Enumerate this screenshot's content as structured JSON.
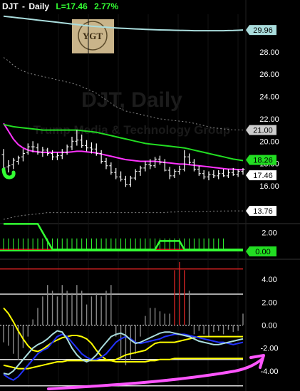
{
  "header": {
    "symbol": "DJT",
    "separator": "-",
    "interval": "Daily",
    "last_label": "L=17.46",
    "change_label": "2.77%"
  },
  "watermark": {
    "title": "DJT, Daily",
    "company": "Trump Media & Technology Group"
  },
  "logo": {
    "text": "YGT",
    "badge_color": "#c9b48a"
  },
  "colors": {
    "background": "#000000",
    "price_bars": "#ffffff",
    "ma_short": "#ff33ff",
    "ma_long": "#22dd22",
    "upper_band": "#aadddd",
    "band_dotted": "#888888",
    "oscillator_green": "#33ff33",
    "zero_red": "#dd2222",
    "hist_gray": "#888888",
    "hist_red": "#cc2222",
    "stoch_yellow": "#ffff00",
    "stoch_blue": "#2233ff",
    "stoch_lightblue": "#aadddd",
    "arrow_magenta": "#ff55ff"
  },
  "chart_data": [
    {
      "type": "line",
      "panel": "price",
      "y_ticks": [
        "28.00",
        "26.00",
        "24.00",
        "22.00",
        "20.00",
        "18.00",
        "16.00"
      ],
      "ylim": [
        13.0,
        31.5
      ],
      "badges": [
        {
          "label": "29.96",
          "bg": "#aadddd",
          "fg": "#000000",
          "value": 29.96
        },
        {
          "label": "21.00",
          "bg": "#cccccc",
          "fg": "#000000",
          "value": 21.0
        },
        {
          "label": "18.26",
          "bg": "#22dd22",
          "fg": "#000000",
          "value": 18.26
        },
        {
          "label": "17.46",
          "bg": "#ffffff",
          "fg": "#000000",
          "value": 17.46
        },
        {
          "label": "13.76",
          "bg": "#ffffff",
          "fg": "#000000",
          "value": 13.76
        }
      ],
      "ohlc": [
        [
          18.8,
          19.3,
          17.3,
          17.6
        ],
        [
          17.7,
          18.3,
          17.2,
          17.8
        ],
        [
          17.9,
          18.5,
          17.5,
          18.3
        ],
        [
          18.2,
          18.7,
          17.9,
          18.5
        ],
        [
          18.6,
          19.3,
          18.2,
          18.9
        ],
        [
          19.0,
          19.8,
          18.8,
          19.5
        ],
        [
          19.5,
          20.0,
          19.0,
          19.5
        ],
        [
          19.4,
          19.8,
          18.8,
          19.0
        ],
        [
          19.0,
          19.5,
          18.6,
          19.2
        ],
        [
          19.2,
          19.4,
          18.7,
          18.9
        ],
        [
          18.9,
          19.2,
          18.3,
          18.6
        ],
        [
          18.6,
          19.0,
          18.3,
          18.7
        ],
        [
          18.7,
          19.3,
          18.4,
          19.0
        ],
        [
          19.0,
          19.7,
          18.8,
          19.5
        ],
        [
          19.5,
          20.4,
          19.2,
          20.0
        ],
        [
          20.0,
          21.0,
          19.6,
          20.1
        ],
        [
          20.1,
          20.6,
          19.4,
          19.6
        ],
        [
          19.6,
          20.1,
          19.1,
          19.4
        ],
        [
          19.4,
          19.9,
          18.9,
          19.3
        ],
        [
          19.3,
          19.8,
          18.7,
          18.9
        ],
        [
          18.9,
          19.2,
          18.0,
          18.2
        ],
        [
          18.2,
          18.5,
          17.5,
          17.8
        ],
        [
          17.8,
          18.1,
          17.0,
          17.2
        ],
        [
          17.2,
          17.6,
          16.6,
          16.8
        ],
        [
          16.8,
          17.3,
          16.4,
          16.6
        ],
        [
          16.6,
          16.9,
          15.9,
          16.1
        ],
        [
          16.1,
          16.9,
          15.9,
          16.7
        ],
        [
          16.7,
          17.5,
          16.5,
          17.3
        ],
        [
          17.3,
          17.8,
          16.9,
          17.6
        ],
        [
          17.6,
          18.2,
          17.3,
          17.9
        ],
        [
          17.9,
          18.4,
          17.5,
          17.8
        ],
        [
          17.8,
          18.6,
          17.6,
          18.4
        ],
        [
          18.4,
          18.7,
          17.9,
          18.1
        ],
        [
          18.1,
          18.4,
          17.3,
          17.4
        ],
        [
          17.4,
          17.7,
          16.6,
          16.9
        ],
        [
          16.9,
          17.5,
          16.7,
          17.3
        ],
        [
          17.3,
          17.8,
          17.0,
          17.5
        ],
        [
          17.5,
          19.2,
          17.3,
          18.6
        ],
        [
          18.6,
          18.9,
          17.9,
          18.1
        ],
        [
          18.1,
          18.4,
          17.3,
          17.5
        ],
        [
          17.5,
          17.8,
          16.9,
          17.1
        ],
        [
          17.1,
          17.4,
          16.6,
          16.8
        ],
        [
          16.8,
          17.3,
          16.5,
          17.0
        ],
        [
          17.0,
          17.4,
          16.7,
          16.9
        ],
        [
          16.9,
          17.4,
          16.6,
          17.1
        ],
        [
          17.1,
          17.5,
          16.8,
          16.9
        ],
        [
          16.9,
          17.5,
          16.7,
          17.2
        ],
        [
          17.2,
          17.6,
          16.9,
          17.0
        ],
        [
          17.0,
          17.5,
          16.8,
          17.3
        ],
        [
          17.3,
          17.6,
          17.0,
          17.46
        ]
      ],
      "series": [
        {
          "name": "",
          "color": "#ff33ff",
          "values": [
            21.6,
            20.9,
            20.2,
            19.7,
            19.4,
            19.2,
            19.1,
            19.05,
            19.0,
            19.0,
            19.0,
            19.0,
            19.0,
            19.0,
            19.05,
            19.1,
            19.1,
            19.05,
            19.0,
            18.95,
            18.85,
            18.75,
            18.65,
            18.55,
            18.45,
            18.35,
            18.3,
            18.25,
            18.2,
            18.2,
            18.2,
            18.2,
            18.15,
            18.1,
            18.05,
            18.0,
            17.95,
            17.95,
            17.9,
            17.85,
            17.8,
            17.75,
            17.7,
            17.65,
            17.6,
            17.55,
            17.5,
            17.5,
            17.45,
            17.45
          ]
        },
        {
          "name": "",
          "color": "#22dd22",
          "values": [
            21.5,
            21.4,
            21.3,
            21.25,
            21.2,
            21.15,
            21.1,
            21.05,
            21.0,
            21.0,
            21.0,
            21.0,
            21.0,
            21.0,
            21.0,
            21.0,
            20.95,
            20.9,
            20.85,
            20.8,
            20.7,
            20.6,
            20.5,
            20.4,
            20.3,
            20.2,
            20.1,
            20.0,
            19.9,
            19.8,
            19.75,
            19.7,
            19.65,
            19.6,
            19.55,
            19.5,
            19.45,
            19.4,
            19.3,
            19.2,
            19.1,
            19.0,
            18.9,
            18.8,
            18.7,
            18.6,
            18.5,
            18.4,
            18.33,
            18.26
          ]
        },
        {
          "name": "",
          "color": "#aadddd",
          "values": [
            31.2,
            31.15,
            31.1,
            31.05,
            31.0,
            30.95,
            30.9,
            30.85,
            30.8,
            30.75,
            30.7,
            30.65,
            30.6,
            30.55,
            30.5,
            30.45,
            30.4,
            30.35,
            30.3,
            30.27,
            30.24,
            30.21,
            30.18,
            30.15,
            30.12,
            30.1,
            30.08,
            30.06,
            30.04,
            30.02,
            30.0,
            29.98,
            29.97,
            29.96,
            29.95,
            29.94,
            29.93,
            29.92,
            29.91,
            29.9,
            29.9,
            29.9,
            29.9,
            29.9,
            29.9,
            29.9,
            29.91,
            29.92,
            29.94,
            29.96
          ]
        },
        {
          "name": "",
          "color": "#888888",
          "dashed": true,
          "values": [
            27.5,
            27.2,
            26.8,
            26.5,
            26.3,
            26.1,
            26.0,
            25.9,
            25.8,
            25.7,
            25.6,
            25.5,
            25.4,
            25.3,
            25.2,
            25.05,
            24.9,
            24.7,
            24.5,
            24.3,
            24.0,
            23.7,
            23.4,
            23.1,
            22.9,
            22.7,
            22.6,
            22.5,
            22.4,
            22.3,
            22.2,
            22.1,
            22.0,
            21.95,
            21.9,
            21.85,
            21.8,
            21.75,
            21.7,
            21.6,
            21.5,
            21.4,
            21.3,
            21.2,
            21.15,
            21.1,
            21.05,
            21.02,
            21.01,
            21.0
          ]
        },
        {
          "name": "",
          "color": "#888888",
          "dashed": true,
          "values": [
            13.0,
            13.1,
            13.2,
            13.3,
            13.35,
            13.4,
            13.45,
            13.5,
            13.55,
            13.6,
            13.6,
            13.6,
            13.6,
            13.6,
            13.6,
            13.6,
            13.6,
            13.6,
            13.6,
            13.6,
            13.6,
            13.6,
            13.6,
            13.6,
            13.6,
            13.6,
            13.6,
            13.6,
            13.6,
            13.6,
            13.6,
            13.6,
            13.6,
            13.6,
            13.65,
            13.65,
            13.7,
            13.7,
            13.7,
            13.7,
            13.7,
            13.72,
            13.72,
            13.74,
            13.74,
            13.75,
            13.75,
            13.76,
            13.76,
            13.76
          ]
        }
      ]
    },
    {
      "type": "bar",
      "panel": "oscillator",
      "y_ticks": [
        "2.00",
        "0.00"
      ],
      "ylim": [
        -0.3,
        3.2
      ],
      "badges": [
        {
          "label": "0.00",
          "bg": "#22dd22",
          "fg": "#000000",
          "value": 0.0
        }
      ],
      "values": [
        3,
        3,
        3,
        3,
        3,
        3,
        3,
        3,
        2,
        1,
        0,
        0,
        0,
        0,
        0,
        0,
        0,
        0,
        0,
        0,
        0,
        0,
        0,
        0,
        0,
        0,
        0,
        0,
        0,
        0,
        0,
        0,
        1,
        1,
        1,
        1,
        1,
        0,
        0,
        0,
        0,
        0,
        0,
        0,
        0,
        0,
        0,
        0,
        0,
        0
      ],
      "hist": [
        1,
        1,
        1,
        1,
        1,
        1,
        1,
        1,
        1,
        1,
        1,
        1,
        1,
        1,
        1,
        1,
        1,
        1,
        1,
        1,
        1,
        1,
        1,
        1,
        1,
        1,
        1,
        1,
        1,
        1,
        1,
        1,
        1,
        1,
        1,
        1,
        1,
        1,
        1,
        1,
        1,
        1,
        1,
        1,
        1,
        1,
        0,
        0,
        0,
        0
      ]
    },
    {
      "type": "bar",
      "panel": "momentum",
      "y_ticks": [
        "4.00",
        "2.00",
        "0.00",
        "-2.00",
        "-4.00"
      ],
      "ylim": [
        -5.5,
        5.5
      ],
      "reference_lines": [
        4.9,
        2.7,
        -3.0,
        -5.3
      ],
      "values": [
        -1.5,
        -1.8,
        -2.5,
        -3.0,
        -2.0,
        -1.0,
        0.5,
        1.5,
        2.5,
        3.5,
        3.0,
        2.5,
        3.5,
        3.0,
        2.8,
        3.5,
        3.0,
        1.8,
        2.5,
        2.8,
        2.5,
        3.0,
        3.5,
        -1.0,
        -3.0,
        -3.5,
        -3.0,
        -2.5,
        -1.0,
        0.8,
        1.5,
        1.5,
        1.2,
        1.0,
        1.0,
        4.8,
        5.5,
        4.8,
        3.0,
        -0.8,
        -0.5,
        -0.8,
        -1.0,
        -0.6,
        -0.5,
        -0.8,
        -0.4,
        -0.6,
        -0.5,
        1.0
      ],
      "series": [
        {
          "name": "",
          "color": "#ffff00",
          "values": [
            1.5,
            1.0,
            0.3,
            -0.5,
            -1.2,
            -1.8,
            -2.2,
            -2.3,
            -2.1,
            -1.8,
            -1.5,
            -1.3,
            -1.1,
            -1.0,
            -0.9,
            -0.9,
            -1.0,
            -1.2,
            -1.6,
            -2.2,
            -2.7,
            -3.0,
            -3.1,
            -3.0,
            -2.8,
            -2.6,
            -2.5,
            -2.4,
            -2.3,
            -2.2,
            -1.9,
            -1.6,
            -1.5,
            -1.5,
            -1.5,
            -1.5,
            -1.4,
            -1.3,
            -1.2,
            -1.1,
            -1.0,
            -1.0,
            -1.0,
            -1.0,
            -1.0,
            -1.0,
            -1.0,
            -1.0,
            -1.0,
            -1.0
          ]
        },
        {
          "name": "",
          "color": "#ffff00",
          "values": [
            -3.5,
            -3.6,
            -3.7,
            -3.8,
            -3.8,
            -3.8,
            -3.7,
            -3.6,
            -3.5,
            -3.4,
            -3.3,
            -3.2,
            -3.2,
            -3.1,
            -3.1,
            -3.1,
            -3.1,
            -3.1,
            -3.1,
            -3.1,
            -3.1,
            -3.1,
            -3.1,
            -3.2,
            -3.2,
            -3.2,
            -3.2,
            -3.2,
            -3.2,
            -3.2,
            -3.1,
            -3.1,
            -3.0,
            -3.0,
            -3.0,
            -2.9,
            -2.9,
            -2.9,
            -2.9,
            -2.9,
            -2.9,
            -2.9,
            -2.9,
            -2.9,
            -2.9,
            -2.9,
            -2.9,
            -2.9,
            -2.9,
            -2.9
          ]
        },
        {
          "name": "",
          "color": "#2233ff",
          "values": [
            -4.3,
            -4.6,
            -4.8,
            -4.5,
            -4.0,
            -3.5,
            -3.0,
            -2.5,
            -2.2,
            -2.0,
            -1.5,
            -1.0,
            -0.8,
            -1.0,
            -1.5,
            -2.0,
            -2.5,
            -2.8,
            -3.0,
            -3.0,
            -2.8,
            -2.5,
            -2.0,
            -1.5,
            -1.2,
            -1.0,
            -1.2,
            -1.5,
            -1.6,
            -1.5,
            -1.4,
            -1.3,
            -1.2,
            -1.0,
            -0.9,
            -0.8,
            -0.8,
            -0.8,
            -0.9,
            -1.0,
            -1.1,
            -1.2,
            -1.3,
            -1.4,
            -1.5,
            -1.5,
            -1.6,
            -1.7,
            -1.6,
            -1.5
          ]
        },
        {
          "name": "",
          "color": "#aadddd",
          "values": [
            -4.2,
            -4.3,
            -4.0,
            -3.5,
            -3.0,
            -2.5,
            -2.0,
            -1.7,
            -1.5,
            -1.2,
            -0.8,
            -0.5,
            -0.6,
            -1.2,
            -2.0,
            -2.6,
            -3.0,
            -3.2,
            -3.0,
            -2.6,
            -2.0,
            -1.5,
            -1.0,
            -0.8,
            -0.7,
            -0.9,
            -1.3,
            -1.6,
            -1.5,
            -1.3,
            -1.1,
            -0.9,
            -0.7,
            -0.6,
            -0.6,
            -0.7,
            -0.8,
            -0.9,
            -1.0,
            -1.2,
            -1.4,
            -1.5,
            -1.6,
            -1.7,
            -1.7,
            -1.6,
            -1.5,
            -1.4,
            -1.3,
            -1.2
          ]
        }
      ]
    }
  ]
}
